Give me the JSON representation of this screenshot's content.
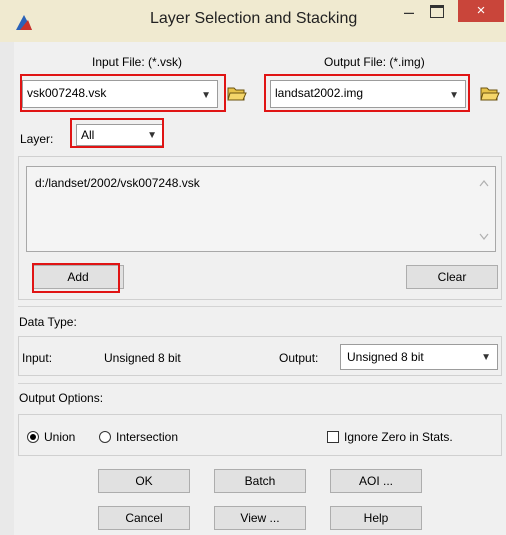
{
  "window": {
    "title": "Layer Selection and Stacking",
    "controls": {
      "minimize": "–",
      "maximize": "□",
      "close": "×"
    }
  },
  "input_file": {
    "label": "Input File: (*.vsk)",
    "value": "vsk007248.vsk"
  },
  "output_file": {
    "label": "Output File: (*.img)",
    "value": "landsat2002.img"
  },
  "layer": {
    "label": "Layer:",
    "value": "All"
  },
  "file_list": {
    "items": [
      "d:/landset/2002/vsk007248.vsk"
    ]
  },
  "buttons": {
    "add": "Add",
    "clear": "Clear",
    "ok": "OK",
    "batch": "Batch",
    "aoi": "AOI ...",
    "cancel": "Cancel",
    "view": "View ...",
    "help": "Help"
  },
  "data_type": {
    "section": "Data Type:",
    "input_label": "Input:",
    "input_value": "Unsigned 8 bit",
    "output_label": "Output:",
    "output_value": "Unsigned 8 bit"
  },
  "output_options": {
    "section": "Output Options:",
    "union": "Union",
    "intersection": "Intersection",
    "selected": "Union",
    "ignore_zero": "Ignore Zero in Stats.",
    "ignore_zero_checked": false
  },
  "icons": {
    "app": "app-logo-icon",
    "folder": "open-folder-icon",
    "dropdown": "chevron-down-icon"
  },
  "colors": {
    "highlight": "#e01414",
    "close_button": "#c9453a"
  }
}
